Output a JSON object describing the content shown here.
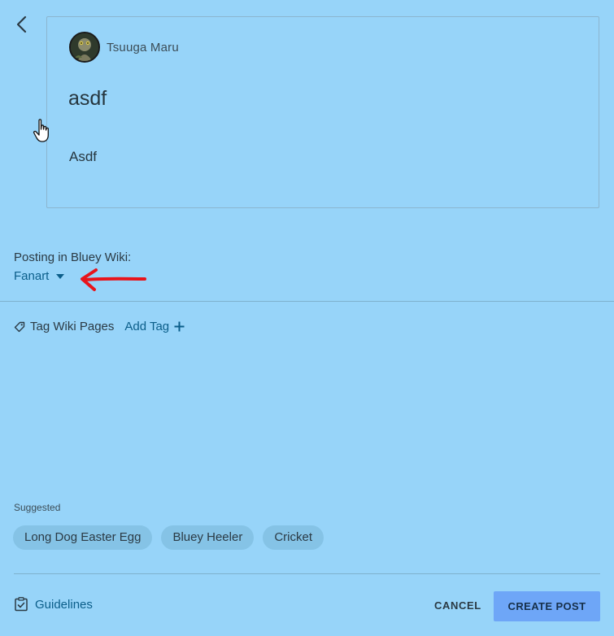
{
  "post": {
    "author_name": "Tsuuga Maru",
    "title": "asdf",
    "body": "Asdf"
  },
  "posting": {
    "label": "Posting in Bluey Wiki:",
    "category": "Fanart"
  },
  "tags": {
    "label": "Tag Wiki Pages",
    "add_label": "Add Tag"
  },
  "suggested": {
    "label": "Suggested",
    "items": [
      "Long Dog Easter Egg",
      "Bluey Heeler",
      "Cricket"
    ]
  },
  "footer": {
    "guidelines_label": "Guidelines",
    "cancel_label": "CANCEL",
    "create_label": "CREATE POST"
  },
  "icons": {
    "back": "chevron-left-icon",
    "tag": "tag-icon",
    "add": "plus-icon",
    "guidelines": "clipboard-check-icon",
    "dropdown": "caret-down-icon"
  },
  "colors": {
    "background": "#97d4f9",
    "link": "#0b5e8a",
    "primary_button": "#6ea6f7",
    "chip": "#85c3e6",
    "annotation_arrow": "#e8141b"
  }
}
